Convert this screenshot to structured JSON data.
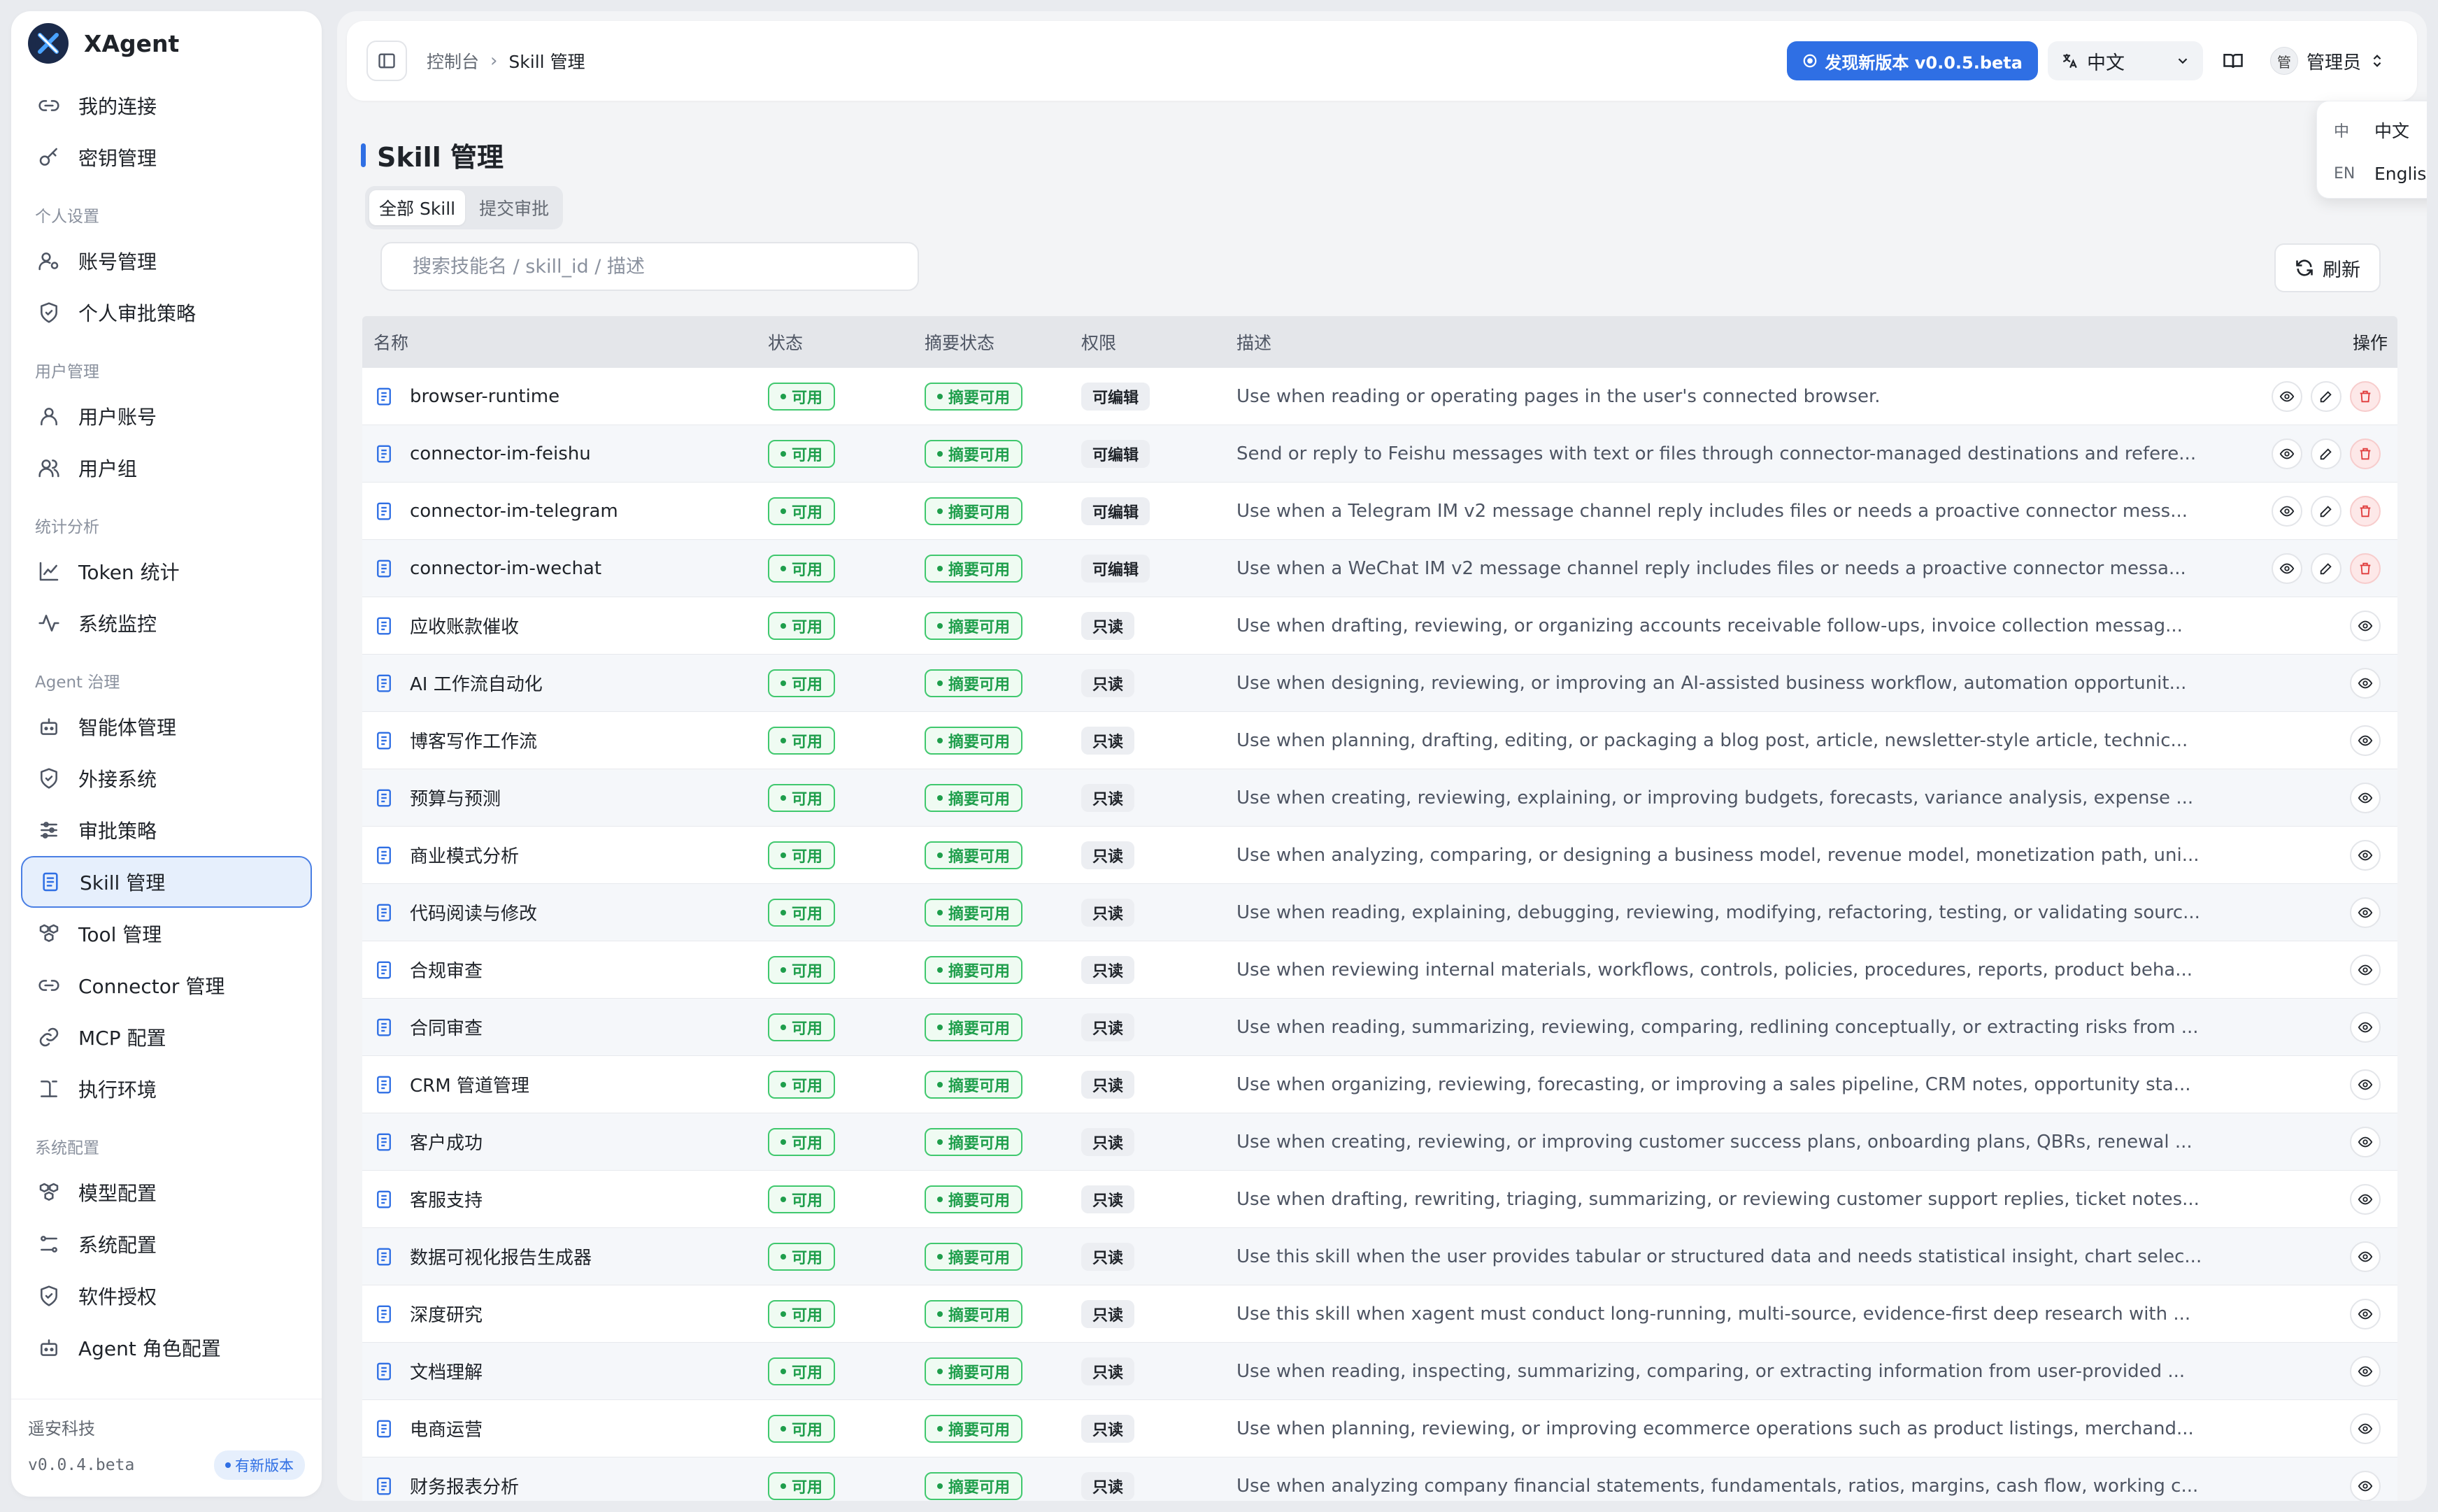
{
  "brand": {
    "name": "XAgent"
  },
  "sidebar": {
    "items_top": [
      {
        "label": "我的连接",
        "icon": "link-icon"
      },
      {
        "label": "密钥管理",
        "icon": "key-icon"
      }
    ],
    "groups": [
      {
        "title": "个人设置",
        "items": [
          {
            "label": "账号管理",
            "icon": "user-settings-icon"
          },
          {
            "label": "个人审批策略",
            "icon": "shield-icon"
          }
        ]
      },
      {
        "title": "用户管理",
        "items": [
          {
            "label": "用户账号",
            "icon": "user-icon"
          },
          {
            "label": "用户组",
            "icon": "users-icon"
          }
        ]
      },
      {
        "title": "统计分析",
        "items": [
          {
            "label": "Token 统计",
            "icon": "line-chart-icon"
          },
          {
            "label": "系统监控",
            "icon": "activity-icon"
          }
        ]
      },
      {
        "title": "Agent 治理",
        "items": [
          {
            "label": "智能体管理",
            "icon": "bot-icon"
          },
          {
            "label": "外接系统",
            "icon": "shield-icon"
          },
          {
            "label": "审批策略",
            "icon": "sliders-icon"
          },
          {
            "label": "Skill 管理",
            "icon": "document-icon",
            "active": true
          },
          {
            "label": "Tool 管理",
            "icon": "boxes-icon"
          },
          {
            "label": "Connector 管理",
            "icon": "link-icon"
          },
          {
            "label": "MCP 配置",
            "icon": "chain-icon"
          },
          {
            "label": "执行环境",
            "icon": "terminal-icon"
          }
        ]
      },
      {
        "title": "系统配置",
        "items": [
          {
            "label": "模型配置",
            "icon": "boxes-icon"
          },
          {
            "label": "系统配置",
            "icon": "settings-icon"
          },
          {
            "label": "软件授权",
            "icon": "shield-icon"
          },
          {
            "label": "Agent 角色配置",
            "icon": "bot-icon"
          }
        ]
      }
    ],
    "footer": {
      "company": "遥安科技",
      "version": "v0.0.4.beta",
      "badge": "有新版本"
    }
  },
  "topbar": {
    "breadcrumb": [
      "控制台",
      "Skill 管理"
    ],
    "update_label": "发现新版本 v0.0.5.beta",
    "language": "中文",
    "user": "管理员",
    "avatar_text": "管"
  },
  "lang_menu": [
    {
      "code": "中",
      "label": "中文",
      "selected": true
    },
    {
      "code": "EN",
      "label": "English",
      "selected": false
    }
  ],
  "page": {
    "title": "Skill 管理",
    "tabs": [
      {
        "label": "全部 Skill",
        "active": true
      },
      {
        "label": "提交审批",
        "active": false
      }
    ],
    "search_placeholder": "搜索技能名 / skill_id / 描述",
    "refresh_label": "刷新"
  },
  "table": {
    "headers": {
      "name": "名称",
      "status": "状态",
      "summary": "摘要状态",
      "perm": "权限",
      "desc": "描述",
      "ops": "操作"
    },
    "rows": [
      {
        "name": "browser-runtime",
        "status": "可用",
        "summary": "摘要可用",
        "perm": "可编辑",
        "desc": "Use when reading or operating pages in the user's connected browser.",
        "editable": true
      },
      {
        "name": "connector-im-feishu",
        "status": "可用",
        "summary": "摘要可用",
        "perm": "可编辑",
        "desc": "Send or reply to Feishu messages with text or files through connector-managed destinations and refere...",
        "editable": true
      },
      {
        "name": "connector-im-telegram",
        "status": "可用",
        "summary": "摘要可用",
        "perm": "可编辑",
        "desc": "Use when a Telegram IM v2 message channel reply includes files or needs a proactive connector mess...",
        "editable": true
      },
      {
        "name": "connector-im-wechat",
        "status": "可用",
        "summary": "摘要可用",
        "perm": "可编辑",
        "desc": "Use when a WeChat IM v2 message channel reply includes files or needs a proactive connector messa...",
        "editable": true
      },
      {
        "name": "应收账款催收",
        "status": "可用",
        "summary": "摘要可用",
        "perm": "只读",
        "desc": "Use when drafting, reviewing, or organizing accounts receivable follow-ups, invoice collection messag...",
        "editable": false
      },
      {
        "name": "AI 工作流自动化",
        "status": "可用",
        "summary": "摘要可用",
        "perm": "只读",
        "desc": "Use when designing, reviewing, or improving an AI-assisted business workflow, automation opportunit...",
        "editable": false
      },
      {
        "name": "博客写作工作流",
        "status": "可用",
        "summary": "摘要可用",
        "perm": "只读",
        "desc": "Use when planning, drafting, editing, or packaging a blog post, article, newsletter-style article, technic...",
        "editable": false
      },
      {
        "name": "预算与预测",
        "status": "可用",
        "summary": "摘要可用",
        "perm": "只读",
        "desc": "Use when creating, reviewing, explaining, or improving budgets, forecasts, variance analysis, expense ...",
        "editable": false
      },
      {
        "name": "商业模式分析",
        "status": "可用",
        "summary": "摘要可用",
        "perm": "只读",
        "desc": "Use when analyzing, comparing, or designing a business model, revenue model, monetization path, uni...",
        "editable": false
      },
      {
        "name": "代码阅读与修改",
        "status": "可用",
        "summary": "摘要可用",
        "perm": "只读",
        "desc": "Use when reading, explaining, debugging, reviewing, modifying, refactoring, testing, or validating sourc...",
        "editable": false
      },
      {
        "name": "合规审查",
        "status": "可用",
        "summary": "摘要可用",
        "perm": "只读",
        "desc": "Use when reviewing internal materials, workflows, controls, policies, procedures, reports, product beha...",
        "editable": false
      },
      {
        "name": "合同审查",
        "status": "可用",
        "summary": "摘要可用",
        "perm": "只读",
        "desc": "Use when reading, summarizing, reviewing, comparing, redlining conceptually, or extracting risks from ...",
        "editable": false
      },
      {
        "name": "CRM 管道管理",
        "status": "可用",
        "summary": "摘要可用",
        "perm": "只读",
        "desc": "Use when organizing, reviewing, forecasting, or improving a sales pipeline, CRM notes, opportunity sta...",
        "editable": false
      },
      {
        "name": "客户成功",
        "status": "可用",
        "summary": "摘要可用",
        "perm": "只读",
        "desc": "Use when creating, reviewing, or improving customer success plans, onboarding plans, QBRs, renewal ...",
        "editable": false
      },
      {
        "name": "客服支持",
        "status": "可用",
        "summary": "摘要可用",
        "perm": "只读",
        "desc": "Use when drafting, rewriting, triaging, summarizing, or reviewing customer support replies, ticket notes...",
        "editable": false
      },
      {
        "name": "数据可视化报告生成器",
        "status": "可用",
        "summary": "摘要可用",
        "perm": "只读",
        "desc": "Use this skill when the user provides tabular or structured data and needs statistical insight, chart selec...",
        "editable": false
      },
      {
        "name": "深度研究",
        "status": "可用",
        "summary": "摘要可用",
        "perm": "只读",
        "desc": "Use this skill when xagent must conduct long-running, multi-source, evidence-first deep research with ...",
        "editable": false
      },
      {
        "name": "文档理解",
        "status": "可用",
        "summary": "摘要可用",
        "perm": "只读",
        "desc": "Use when reading, inspecting, summarizing, comparing, or extracting information from user-provided ...",
        "editable": false
      },
      {
        "name": "电商运营",
        "status": "可用",
        "summary": "摘要可用",
        "perm": "只读",
        "desc": "Use when planning, reviewing, or improving ecommerce operations such as product listings, merchand...",
        "editable": false
      },
      {
        "name": "财务报表分析",
        "status": "可用",
        "summary": "摘要可用",
        "perm": "只读",
        "desc": "Use when analyzing company financial statements, fundamentals, ratios, margins, cash flow, working c...",
        "editable": false
      }
    ]
  }
}
